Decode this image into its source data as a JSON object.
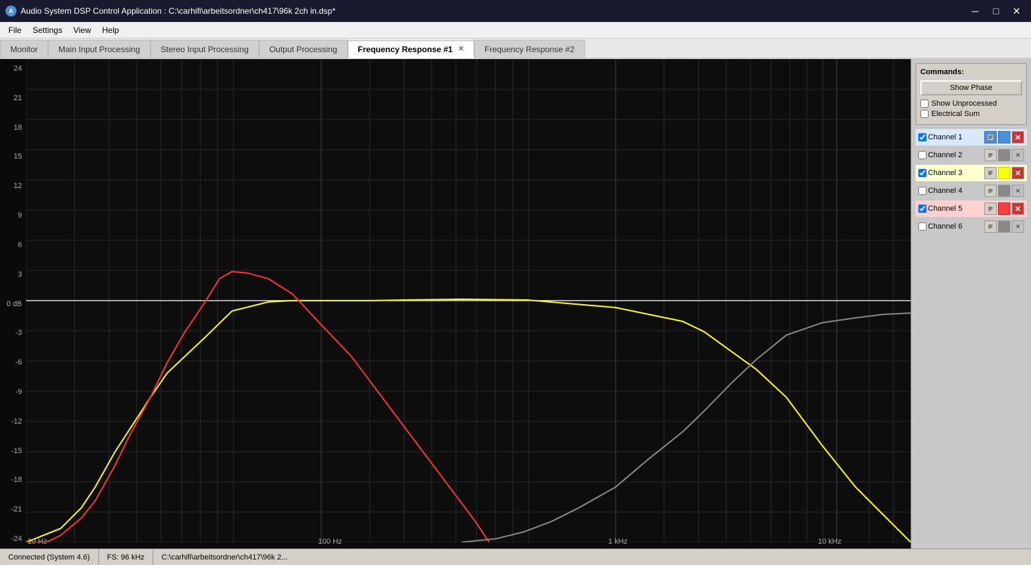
{
  "titleBar": {
    "title": "Audio System DSP Control Application : C:\\carhifi\\arbeitsordner\\ch417\\96k 2ch in.dsp*",
    "icon": "A",
    "controls": [
      "─",
      "□",
      "✕"
    ]
  },
  "menuBar": {
    "items": [
      "File",
      "Settings",
      "View",
      "Help"
    ]
  },
  "tabs": [
    {
      "id": "monitor",
      "label": "Monitor",
      "active": false,
      "closable": false
    },
    {
      "id": "main-input",
      "label": "Main Input Processing",
      "active": false,
      "closable": false
    },
    {
      "id": "stereo-input",
      "label": "Stereo Input Processing",
      "active": false,
      "closable": false
    },
    {
      "id": "output",
      "label": "Output Processing",
      "active": false,
      "closable": false
    },
    {
      "id": "freq1",
      "label": "Frequency Response #1",
      "active": true,
      "closable": true
    },
    {
      "id": "freq2",
      "label": "Frequency Response #2",
      "active": false,
      "closable": false
    }
  ],
  "commands": {
    "title": "Commands:",
    "showPhaseBtn": "Show Phase",
    "showUnprocessed": "Show Unprocessed",
    "electricalSum": "Electrical Sum",
    "showUnprocessedChecked": false,
    "electricalSumChecked": false
  },
  "channels": [
    {
      "id": 1,
      "label": "Channel 1",
      "checked": true,
      "color": "#4a90d9",
      "swatchClass": "ch1-swatch",
      "rowClass": "ch1-row"
    },
    {
      "id": 2,
      "label": "Channel 2",
      "checked": false,
      "color": "#808080",
      "swatchClass": "",
      "rowClass": ""
    },
    {
      "id": 3,
      "label": "Channel 3",
      "checked": true,
      "color": "#ffff00",
      "swatchClass": "ch3-swatch",
      "rowClass": "ch3-row"
    },
    {
      "id": 4,
      "label": "Channel 4",
      "checked": false,
      "color": "#808080",
      "swatchClass": "",
      "rowClass": ""
    },
    {
      "id": 5,
      "label": "Channel 5",
      "checked": true,
      "color": "#ff4040",
      "swatchClass": "ch5-swatch",
      "rowClass": "ch5-row"
    },
    {
      "id": 6,
      "label": "Channel 6",
      "checked": false,
      "color": "#808080",
      "swatchClass": "",
      "rowClass": ""
    }
  ],
  "yAxis": {
    "labels": [
      "24",
      "21",
      "18",
      "15",
      "12",
      "9",
      "6",
      "3",
      "0 dB",
      "-3",
      "-6",
      "-9",
      "-12",
      "-15",
      "-18",
      "-21",
      "-24"
    ]
  },
  "xAxis": {
    "labels": [
      {
        "text": "10 Hz",
        "pct": "0.5"
      },
      {
        "text": "100 Hz",
        "pct": "33"
      },
      {
        "text": "1 kHz",
        "pct": "66"
      },
      {
        "text": "10 kHz",
        "pct": "91"
      }
    ]
  },
  "statusBar": {
    "connected": "Connected (System 4.6)",
    "sampleRate": "FS: 96 kHz",
    "filePath": "C:\\carhifi\\arbeitsordner\\ch417\\96k 2..."
  }
}
